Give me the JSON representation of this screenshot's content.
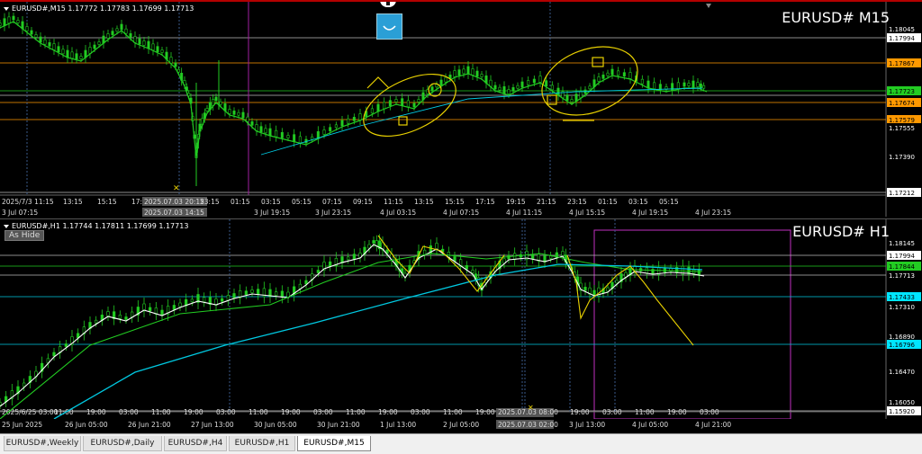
{
  "top_chart": {
    "info": "EURUSD#,M15  1.17772 1.17783 1.17699 1.17713",
    "title": "EURUSD# M15",
    "price_labels": [
      {
        "text": "1.18045",
        "bg": "#000000",
        "fg": "#ffffff"
      },
      {
        "text": "1.17994",
        "bg": "#ffffff",
        "fg": "#000000"
      },
      {
        "text": "1.17867",
        "bg": "#ff9900",
        "fg": "#000000"
      },
      {
        "text": "1.17723",
        "bg": "#22cc22",
        "fg": "#000000"
      },
      {
        "text": "1.17674",
        "bg": "#ff9900",
        "fg": "#000000"
      },
      {
        "text": "1.17579",
        "bg": "#ff9900",
        "fg": "#000000"
      },
      {
        "text": "1.17555",
        "bg": "#000000",
        "fg": "#ffffff"
      },
      {
        "text": "1.17390",
        "bg": "#000000",
        "fg": "#ffffff"
      },
      {
        "text": "1.17212",
        "bg": "#ffffff",
        "fg": "#000000"
      }
    ],
    "time_row1": [
      "2025/7/3 11:15",
      "13:15",
      "15:15",
      "17:15",
      "2025.07.03 20:15",
      "23:15",
      "01:15",
      "03:15",
      "05:15",
      "07:15",
      "09:15",
      "11:15",
      "13:15",
      "15:15",
      "17:15",
      "19:15",
      "21:15",
      "23:15",
      "01:15",
      "03:15",
      "05:15"
    ],
    "time_row2": [
      "3 Jul 07:15",
      "2025.07.03 14:15",
      "3 Jul 19:15",
      "3 Jul 23:15",
      "4 Jul 03:15",
      "4 Jul 07:15",
      "4 Jul 11:15",
      "4 Jul 15:15",
      "4 Jul 19:15",
      "4 Jul 23:15"
    ]
  },
  "bottom_chart": {
    "info": "EURUSD#,H1  1.17744 1.17811 1.17699 1.17713",
    "title": "EURUSD# H1",
    "hide_label": "As Hide",
    "price_labels": [
      {
        "text": "1.18145",
        "bg": "#000000",
        "fg": "#ffffff"
      },
      {
        "text": "1.17994",
        "bg": "#ffffff",
        "fg": "#000000"
      },
      {
        "text": "1.17844",
        "bg": "#22cc22",
        "fg": "#000000"
      },
      {
        "text": "1.17713",
        "bg": "#000000",
        "fg": "#ffffff"
      },
      {
        "text": "1.17433",
        "bg": "#00e5ff",
        "fg": "#000000"
      },
      {
        "text": "1.17310",
        "bg": "#000000",
        "fg": "#ffffff"
      },
      {
        "text": "1.16890",
        "bg": "#000000",
        "fg": "#ffffff"
      },
      {
        "text": "1.16796",
        "bg": "#00e5ff",
        "fg": "#000000"
      },
      {
        "text": "1.16470",
        "bg": "#000000",
        "fg": "#ffffff"
      },
      {
        "text": "1.16050",
        "bg": "#000000",
        "fg": "#ffffff"
      },
      {
        "text": "1.15920",
        "bg": "#ffffff",
        "fg": "#000000"
      }
    ],
    "time_row1": [
      "2025/6/25 03:00",
      "11:00",
      "19:00",
      "03:00",
      "11:00",
      "19:00",
      "03:00",
      "11:00",
      "19:00",
      "03:00",
      "11:00",
      "19:00",
      "03:00",
      "11:00",
      "19:00",
      "2025.07.03 08:00",
      "19:00",
      "03:00",
      "11:00",
      "19:00",
      "03:00"
    ],
    "time_row2": [
      "25 Jun 2025",
      "26 Jun 05:00",
      "26 Jun 21:00",
      "27 Jun 13:00",
      "30 Jun 05:00",
      "30 Jun 21:00",
      "1 Jul 13:00",
      "2 Jul 05:00",
      "2025.07.03 02:00",
      "3 Jul 13:00",
      "4 Jul 05:00",
      "4 Jul 21:00"
    ]
  },
  "tabs": [
    "EURUSD#,Weekly",
    "EURUSD#,Daily",
    "EURUSD#,H4",
    "EURUSD#,H1",
    "EURUSD#,M15"
  ],
  "active_tab": "EURUSD#,M15",
  "colors": {
    "candle": "#22cc22",
    "ma_white": "#ffffff",
    "ma_green": "#22cc22",
    "ma_cyan": "#00c8e0",
    "drawing": "#e8d000",
    "orange_line": "#ff9900",
    "grid": "#2a2a2a"
  }
}
